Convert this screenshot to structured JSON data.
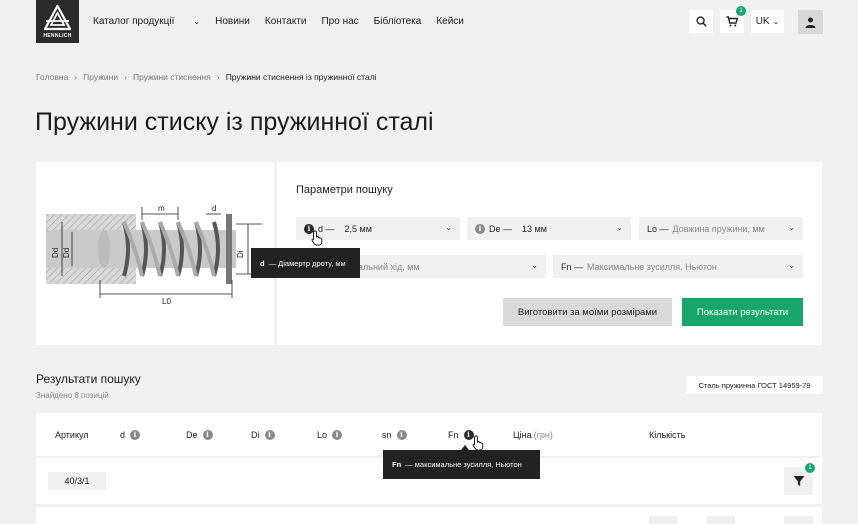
{
  "header": {
    "logo_text": "HENNLICH",
    "nav": [
      {
        "label": "Каталог продукції"
      },
      {
        "label": "Новини"
      },
      {
        "label": "Контакти"
      },
      {
        "label": "Про нас"
      },
      {
        "label": "Бібліотека"
      },
      {
        "label": "Кейси"
      }
    ],
    "cart_count": "1",
    "language": "UK"
  },
  "breadcrumb": [
    "Головна",
    "Пружини",
    "Пружини стиснення",
    "Пружини стиснення із пружинної сталі"
  ],
  "page_title": "Пружини стиску із пружинної сталі",
  "diagram": {
    "labels": [
      "m",
      "d",
      "Dd",
      "Dd",
      "Di",
      "L0"
    ]
  },
  "search": {
    "title": "Параметри пошуку",
    "fields": [
      {
        "label": "d —",
        "value": "2,5 мм"
      },
      {
        "label": "De —",
        "value": "13 мм"
      },
      {
        "label": "Lo —",
        "placeholder": "Довжина пружини, мм"
      },
      {
        "placeholder": "альний хід, мм"
      },
      {
        "label": "Fn —",
        "placeholder": "Максимальне зусилля, Ньютон"
      }
    ],
    "btn_custom": "Виготовити за моїми розмірами",
    "btn_show": "Показати результати"
  },
  "tooltips": {
    "d": {
      "key": "d",
      "text": "— Діамертр дроту, мм"
    },
    "fn": {
      "key": "Fn",
      "text": "— максимальне зусилля, Ньютон"
    }
  },
  "results": {
    "title": "Результати пошуку",
    "count": "Знайдено 8 позицій",
    "badge": "Сталь пружинна ГОСТ 14959-79",
    "columns": [
      {
        "label": "Артикул"
      },
      {
        "label": "d"
      },
      {
        "label": "De"
      },
      {
        "label": "Di"
      },
      {
        "label": "Lo"
      },
      {
        "label": "sn"
      },
      {
        "label": "Fn"
      },
      {
        "label": "Ціна",
        "unit": "(грн)"
      },
      {
        "label": "Кількість"
      }
    ],
    "rows": [
      {
        "article": "40/3/1"
      }
    ],
    "filter_count": "1"
  },
  "colors": {
    "accent": "#17a56e",
    "dark": "#222222",
    "bg": "#f0f0f0"
  }
}
